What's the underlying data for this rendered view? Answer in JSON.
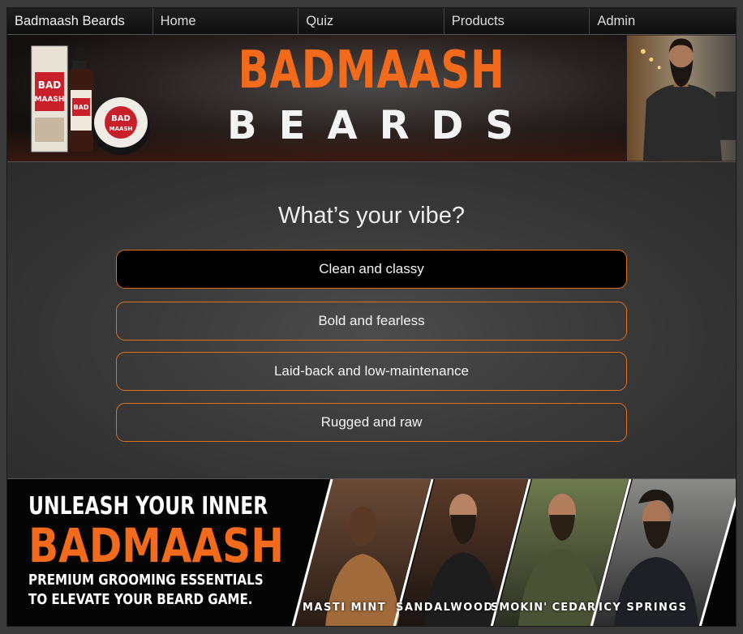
{
  "nav": {
    "items": [
      {
        "label": "Badmaash Beards"
      },
      {
        "label": "Home"
      },
      {
        "label": "Quiz"
      },
      {
        "label": "Products"
      },
      {
        "label": "Admin"
      }
    ]
  },
  "hero": {
    "title": "BADMAASH",
    "subtitle": "BEARDS"
  },
  "quiz": {
    "question": "What’s your vibe?",
    "options": [
      {
        "label": "Clean and classy",
        "selected": true
      },
      {
        "label": "Bold and fearless",
        "selected": false
      },
      {
        "label": "Laid-back and low-maintenance",
        "selected": false
      },
      {
        "label": "Rugged and raw",
        "selected": false
      }
    ]
  },
  "promo": {
    "line1": "UNLEASH YOUR INNER",
    "line2": "BADMAASH",
    "line3": "PREMIUM GROOMING ESSENTIALS",
    "line4": "TO ELEVATE YOUR BEARD GAME.",
    "scents": [
      {
        "label": "MASTI MINT"
      },
      {
        "label": "SANDALWOOD"
      },
      {
        "label": "SMOKIN' CEDAR"
      },
      {
        "label": "ICY SPRINGS"
      }
    ]
  },
  "colors": {
    "accent": "#f26a1b",
    "background": "#3a3a3a",
    "selected_option": "#000000"
  }
}
